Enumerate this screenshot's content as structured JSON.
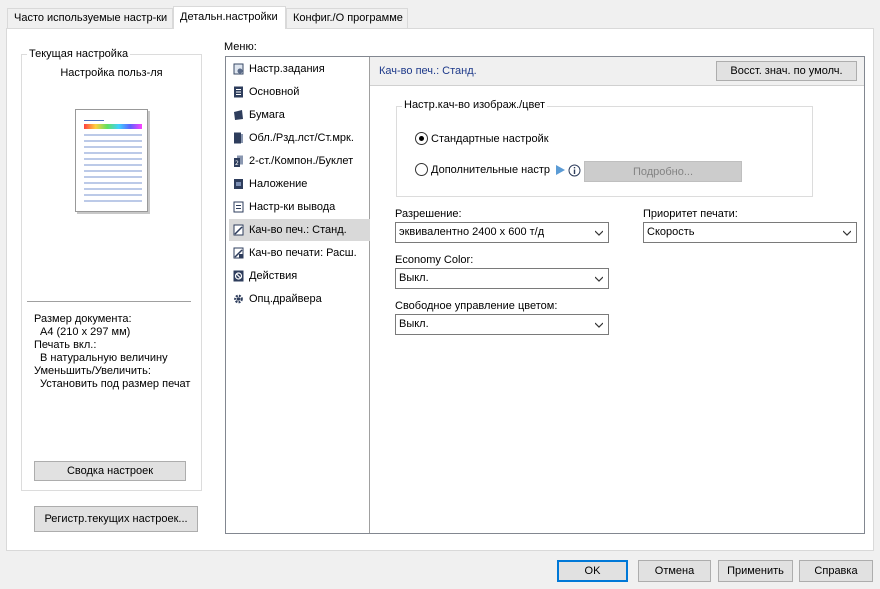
{
  "tabs": [
    {
      "label": "Часто используемые настр-ки",
      "active": false
    },
    {
      "label": "Детальн.настройки",
      "active": true
    },
    {
      "label": "Конфиг./О программе",
      "active": false
    }
  ],
  "current_settings": {
    "group_title": "Текущая настройка",
    "profile_name": "Настройка польз-ля",
    "doc_size_label": "Размер документа:",
    "doc_size_value": "A4 (210 x 297 мм)",
    "print_on_label": "Печать вкл.:",
    "print_on_value": "В натуральную величину",
    "scale_label": "Уменьшить/Увеличить:",
    "scale_value": "Установить под размер печат",
    "summary_button": "Сводка настроек"
  },
  "register_button": "Регистр.текущих настроек...",
  "menu": {
    "label": "Меню:",
    "items": [
      {
        "label": "Настр.задания",
        "icon": "job-settings-icon"
      },
      {
        "label": "Основной",
        "icon": "basic-icon"
      },
      {
        "label": "Бумага",
        "icon": "paper-icon"
      },
      {
        "label": "Обл./Рзд.лст/Ст.мрк.",
        "icon": "cover-icon"
      },
      {
        "label": "2-ст./Компон./Буклет",
        "icon": "duplex-icon"
      },
      {
        "label": "Наложение",
        "icon": "overlay-icon"
      },
      {
        "label": "Настр-ки вывода",
        "icon": "output-icon"
      },
      {
        "label": "Кач-во печ.: Станд.",
        "icon": "quality-icon",
        "selected": true
      },
      {
        "label": "Кач-во печати: Расш.",
        "icon": "quality-advanced-icon"
      },
      {
        "label": "Действия",
        "icon": "actions-icon"
      },
      {
        "label": "Опц.драйвера",
        "icon": "driver-options-icon"
      }
    ]
  },
  "panel": {
    "header_title": "Кач-во печ.: Станд.",
    "restore_button": "Восст. знач. по умолч.",
    "image_group_title": "Настр.кач-во изображ./цвет",
    "radio_standard": "Стандартные настройк",
    "radio_advanced": "Дополнительные настр",
    "details_button": "Подробно...",
    "resolution_label": "Разрешение:",
    "resolution_value": "эквивалентно 2400 x 600 т/д",
    "priority_label": "Приоритет печати:",
    "priority_value": "Скорость",
    "economy_label": "Economy Color:",
    "economy_value": "Выкл.",
    "free_color_label": "Свободное управление цветом:",
    "free_color_value": "Выкл."
  },
  "footer": {
    "ok": "OK",
    "cancel": "Отмена",
    "apply": "Применить",
    "help": "Справка"
  },
  "colors": {
    "accent": "#0078d7",
    "header_text": "#1e3a8a"
  }
}
